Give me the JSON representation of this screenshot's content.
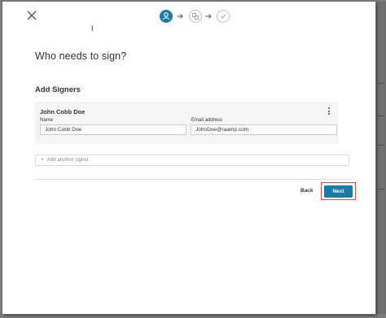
{
  "steps": [
    {
      "name": "signers",
      "icon": "person-icon",
      "active": true
    },
    {
      "name": "fields",
      "icon": "document-fields-icon",
      "active": false
    },
    {
      "name": "review",
      "icon": "check-icon",
      "active": false
    }
  ],
  "cursor_glyph": "I",
  "page": {
    "title": "Who needs to sign?",
    "subtitle": "Add Signers"
  },
  "signer": {
    "display_name": "John Cobb Doe",
    "name_label": "Name",
    "name_value": "John Cobb Doe",
    "email_label": "Email address",
    "email_value": "JohnDoe@raamp.com"
  },
  "add_signer_label": "Add another signer",
  "actions": {
    "back_label": "Back",
    "next_label": "Next"
  },
  "colors": {
    "accent": "#1d7aa8",
    "highlight": "#e05151"
  }
}
